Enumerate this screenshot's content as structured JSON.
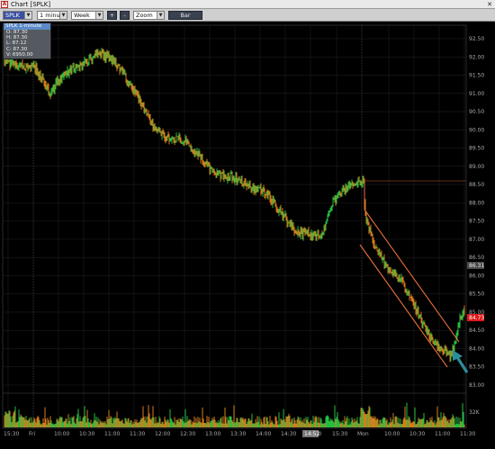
{
  "window": {
    "icon_letter": "A",
    "title": "Chart [SPLK]",
    "close_glyph": "✕"
  },
  "toolbar": {
    "symbol": "SPLK",
    "interval": "1 minute",
    "period": "Week",
    "zoom_in": "+",
    "zoom_out": "-",
    "zoom": "Zoom",
    "style": "Bar"
  },
  "ohlc_box": {
    "header": "SPLK 1-minute",
    "open": "O: 87.30",
    "high": "H: 87.30",
    "low": "L: 87.12",
    "close": "C: 87.30",
    "volume": "V: 6950.00"
  },
  "price_axis": {
    "labels": [
      "92.50",
      "92.00",
      "91.50",
      "91.00",
      "90.50",
      "90.00",
      "89.50",
      "89.00",
      "88.50",
      "88.00",
      "87.50",
      "87.00",
      "86.50",
      "86.00",
      "85.50",
      "85.00",
      "84.50",
      "84.00",
      "83.50",
      "83.00"
    ],
    "current_tag": "86.31",
    "last_price_tag": "84.73",
    "last_price_color": "#e01818"
  },
  "volume_axis": {
    "label": "32K"
  },
  "time_axis": {
    "labels": [
      "15:30",
      "Fri",
      "10:00",
      "10:30",
      "11:00",
      "11:30",
      "12:00",
      "12:30",
      "13:00",
      "13:30",
      "14:00",
      "14:30",
      "15:00",
      "15:30",
      "Mon",
      "10:00",
      "10:30",
      "11:00",
      "11:30"
    ],
    "cursor_tag": "14:52"
  },
  "colors": {
    "up": "#2bd44a",
    "down": "#f28a1e",
    "channel": "#e87038",
    "arrow": "#2b8e9b",
    "grid": "#1e1e1e"
  },
  "icons": {
    "dropdown": "triangle-down",
    "arrow_annotation": "teal-arrow"
  }
}
